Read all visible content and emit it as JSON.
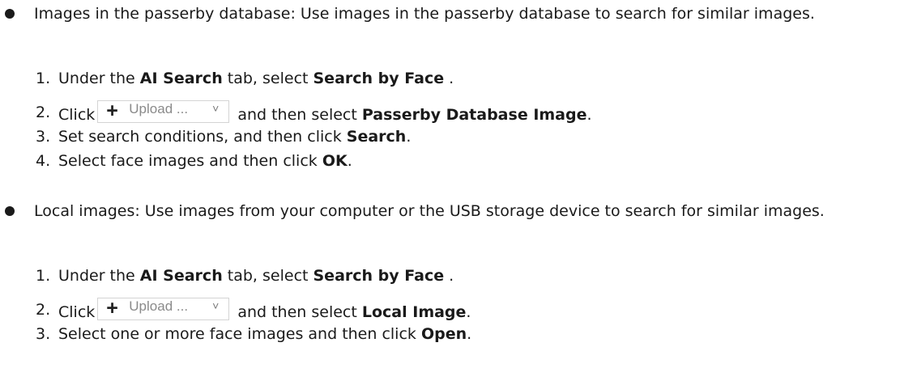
{
  "sections": [
    {
      "intro": "Images in the passerby database: Use images in the passerby database to search for similar images.",
      "steps": [
        {
          "num": "1.",
          "pre": "Under the ",
          "b1": "AI Search",
          "mid": "  tab, select ",
          "b2": "Search by Face",
          "post": " ."
        },
        {
          "num": "2.",
          "pre": "Click",
          "button": {
            "plus": "+",
            "label": "Upload ...",
            "chevron": "˅"
          },
          "mid": " and then select ",
          "b1": "Passerby Database Image",
          "post": "."
        },
        {
          "num": "3.",
          "pre": "Set search conditions, and then click ",
          "b1": "Search",
          "post": "."
        },
        {
          "num": "4.",
          "pre": "Select face images and then click ",
          "b1": "OK",
          "post": "."
        }
      ]
    },
    {
      "intro": "Local images: Use images from your computer or the USB storage device to search for similar images.",
      "steps": [
        {
          "num": "1.",
          "pre": "Under the ",
          "b1": "AI Search",
          "mid": "  tab, select ",
          "b2": "Search by Face",
          "post": " ."
        },
        {
          "num": "2.",
          "pre": "Click",
          "button": {
            "plus": "+",
            "label": "Upload ...",
            "chevron": "˅"
          },
          "mid": " and then select ",
          "b1": "Local Image",
          "post": "."
        },
        {
          "num": "3.",
          "pre": "Select one or more face images and then click ",
          "b1": "Open",
          "post": "."
        }
      ]
    }
  ]
}
